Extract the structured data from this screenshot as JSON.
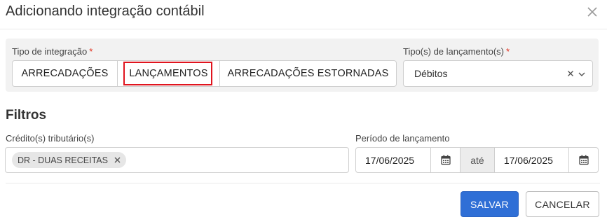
{
  "modal": {
    "title": "Adicionando integração contábil",
    "close_icon": "close-icon"
  },
  "integration_type": {
    "label": "Tipo de integração",
    "required_mark": "*",
    "options": [
      "ARRECADAÇÕES",
      "LANÇAMENTOS",
      "ARRECADAÇÕES ESTORNADAS"
    ],
    "selected": "LANÇAMENTOS"
  },
  "entry_types": {
    "label": "Tipo(s) de lançamento(s)",
    "required_mark": "*",
    "value": "Débitos",
    "clear_icon": "clear-icon",
    "dropdown_icon": "chevron-down-icon"
  },
  "filters": {
    "title": "Filtros",
    "credits": {
      "label": "Crédito(s) tributário(s)",
      "tags": [
        "DR - DUAS RECEITAS"
      ]
    },
    "period": {
      "label": "Período de lançamento",
      "start": "17/06/2025",
      "separator": "até",
      "end": "17/06/2025",
      "calendar_icon": "calendar-icon"
    }
  },
  "actions": {
    "save": "SALVAR",
    "cancel": "CANCELAR"
  },
  "colors": {
    "primary": "#2f6fd6",
    "required": "#e0301e",
    "highlight": "#e0141e",
    "panel_bg": "#f2f2f2"
  }
}
